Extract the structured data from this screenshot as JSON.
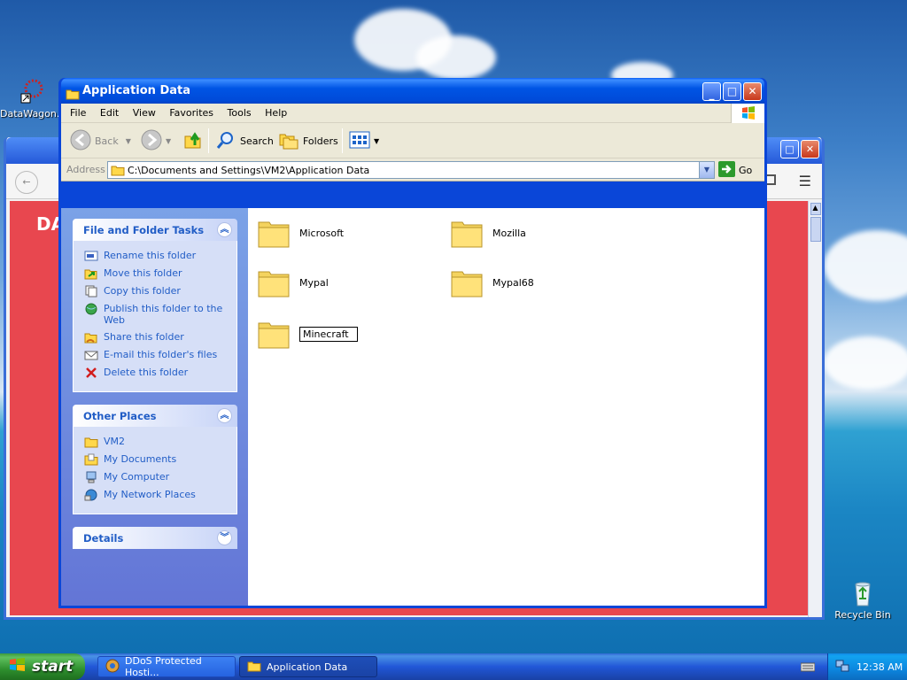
{
  "desktop": {
    "icons": [
      {
        "label": "DataWagon..."
      },
      {
        "label": "Recycle Bin"
      }
    ]
  },
  "window": {
    "title": "Application Data",
    "menu": [
      "File",
      "Edit",
      "View",
      "Favorites",
      "Tools",
      "Help"
    ],
    "toolbar": {
      "back_label": "Back",
      "search_label": "Search",
      "folders_label": "Folders"
    },
    "address": {
      "label": "Address",
      "value": "C:\\Documents and Settings\\VM2\\Application Data",
      "go_label": "Go"
    }
  },
  "taskpane": {
    "file_tasks": {
      "title": "File and Folder Tasks",
      "items": [
        {
          "label": "Rename this folder",
          "icon": "rename-icon"
        },
        {
          "label": "Move this folder",
          "icon": "move-icon"
        },
        {
          "label": "Copy this folder",
          "icon": "copy-icon"
        },
        {
          "label": "Publish this folder to the Web",
          "icon": "publish-web-icon"
        },
        {
          "label": "Share this folder",
          "icon": "share-icon"
        },
        {
          "label": "E-mail this folder's files",
          "icon": "email-icon"
        },
        {
          "label": "Delete this folder",
          "icon": "delete-icon"
        }
      ]
    },
    "other_places": {
      "title": "Other Places",
      "items": [
        {
          "label": "VM2",
          "icon": "folder-icon"
        },
        {
          "label": "My Documents",
          "icon": "my-documents-icon"
        },
        {
          "label": "My Computer",
          "icon": "my-computer-icon"
        },
        {
          "label": "My Network Places",
          "icon": "network-places-icon"
        }
      ]
    },
    "details": {
      "title": "Details"
    }
  },
  "files": [
    {
      "name": "Microsoft"
    },
    {
      "name": "Mozilla"
    },
    {
      "name": "Mypal"
    },
    {
      "name": "Mypal68"
    },
    {
      "name": "Minecraft",
      "renaming": true
    }
  ],
  "taskbar": {
    "start_label": "start",
    "tasks": [
      {
        "label": "DDoS Protected Hosti...",
        "active": false
      },
      {
        "label": "Application Data",
        "active": true
      }
    ],
    "clock": "12:38 AM"
  },
  "colors": {
    "xp_blue": "#0a46d8",
    "task_link": "#215dc6",
    "browser_page": "#e8474f",
    "start_green": "#3c9a3c"
  }
}
